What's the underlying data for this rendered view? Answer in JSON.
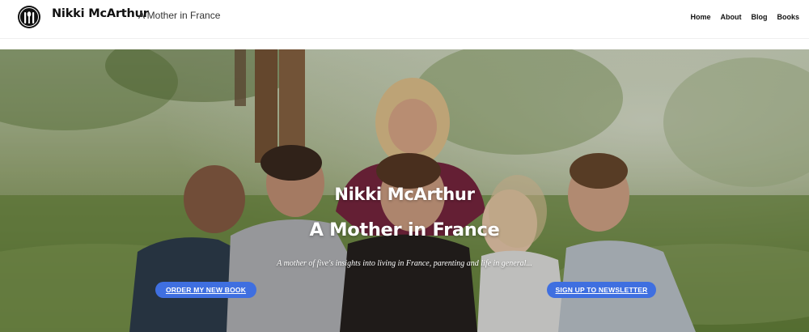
{
  "header": {
    "title": "Nikki McArthur",
    "tagline": "A Mother in France",
    "logo_icon": "fork-spoon-knife-logo-icon"
  },
  "nav": {
    "items": [
      "Home",
      "About",
      "Blog",
      "Books"
    ]
  },
  "hero": {
    "title": "Nikki McArthur",
    "subtitle": "A Mother in France",
    "description": "A mother of five's insights into living in France, parenting and life in general...",
    "buttons": {
      "book": "ORDER MY NEW BOOK",
      "newsletter": "SIGN UP TO NEWSLETTER"
    }
  },
  "colors": {
    "button": "#3f6fe0",
    "text": "#111111",
    "hero_text": "#ffffff"
  }
}
